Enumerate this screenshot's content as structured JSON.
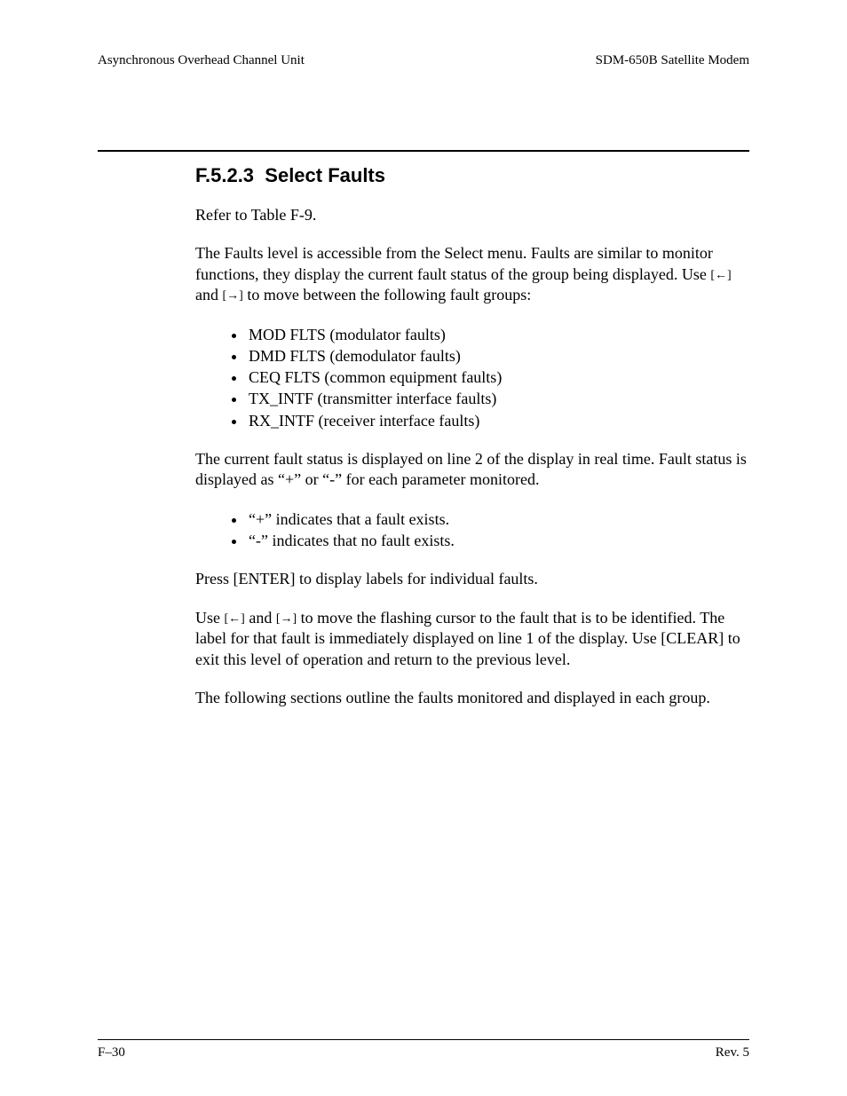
{
  "header": {
    "left": "Asynchronous Overhead Channel Unit",
    "right": "SDM-650B Satellite Modem"
  },
  "section": {
    "number": "F.5.2.3",
    "title": "Select Faults"
  },
  "p1": "Refer to Table F-9.",
  "p2a": "The Faults level is accessible from the Select menu. Faults are similar to monitor functions, they display the current fault status of the group being displayed. Use ",
  "p2b": " and ",
  "p2c": " to move between the following fault groups:",
  "arrows": {
    "left": "[←]",
    "right": "[→]"
  },
  "list1": [
    "MOD FLTS (modulator faults)",
    "DMD FLTS (demodulator faults)",
    "CEQ FLTS (common equipment faults)",
    "TX_INTF (transmitter interface faults)",
    "RX_INTF (receiver interface faults)"
  ],
  "p3": "The current fault status is displayed on line 2 of the display in real time. Fault status is displayed as “+” or “-” for each parameter monitored.",
  "list2": [
    "“+” indicates that a fault exists.",
    "“-” indicates that no fault exists."
  ],
  "p4": "Press [ENTER] to display labels for individual faults.",
  "p5a": "Use ",
  "p5b": " and ",
  "p5c": " to move the flashing cursor to the fault that is to be identified. The label for that fault is immediately displayed on line 1 of the display. Use [CLEAR] to exit this level of operation and return to the previous level.",
  "p6": "The following sections outline the faults monitored and displayed in each group.",
  "footer": {
    "left": "F–30",
    "right": "Rev. 5"
  }
}
